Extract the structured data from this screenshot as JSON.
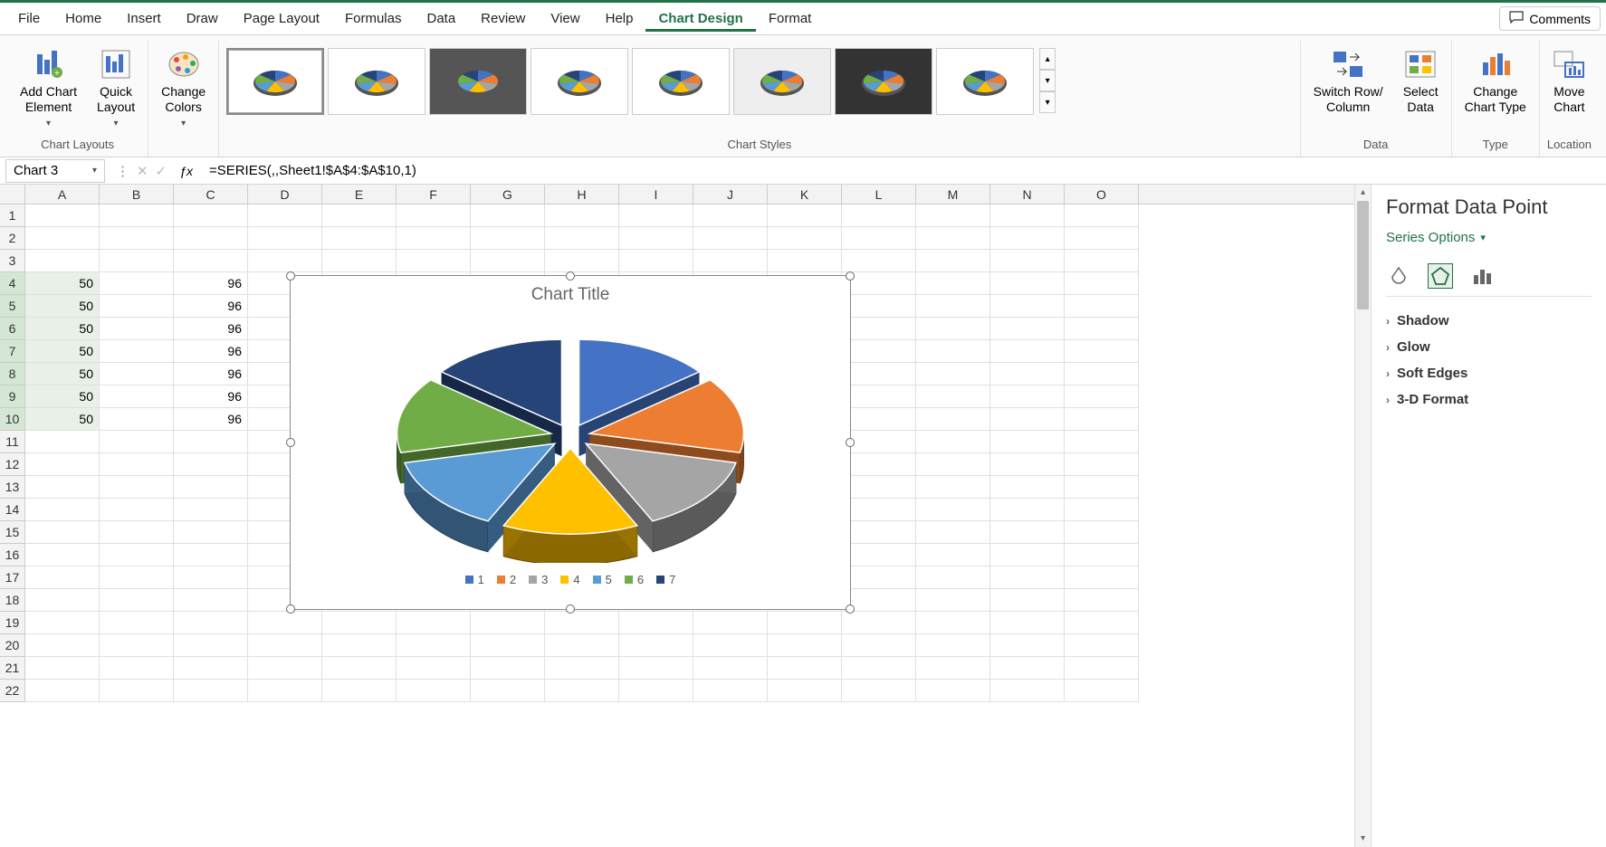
{
  "menu": {
    "items": [
      "File",
      "Home",
      "Insert",
      "Draw",
      "Page Layout",
      "Formulas",
      "Data",
      "Review",
      "View",
      "Help",
      "Chart Design",
      "Format"
    ],
    "active_index": 10,
    "comments": "Comments"
  },
  "ribbon": {
    "chart_layouts": {
      "label": "Chart Layouts",
      "add_element": "Add Chart\nElement",
      "quick_layout": "Quick\nLayout"
    },
    "change_colors": "Change\nColors",
    "chart_styles_label": "Chart Styles",
    "data": {
      "label": "Data",
      "switch": "Switch Row/\nColumn",
      "select": "Select\nData"
    },
    "type": {
      "label": "Type",
      "change": "Change\nChart Type"
    },
    "location": {
      "label": "Location",
      "move": "Move\nChart"
    }
  },
  "formula_bar": {
    "name_box": "Chart 3",
    "formula": "=SERIES(,,Sheet1!$A$4:$A$10,1)"
  },
  "grid": {
    "columns": [
      "A",
      "B",
      "C",
      "D",
      "E",
      "F",
      "G",
      "H",
      "I",
      "J",
      "K",
      "L",
      "M",
      "N",
      "O"
    ],
    "rows": [
      {
        "n": 1,
        "A": "",
        "B": "",
        "C": ""
      },
      {
        "n": 2,
        "A": "",
        "B": "",
        "C": ""
      },
      {
        "n": 3,
        "A": "",
        "B": "",
        "C": ""
      },
      {
        "n": 4,
        "A": "50",
        "B": "",
        "C": "96"
      },
      {
        "n": 5,
        "A": "50",
        "B": "",
        "C": "96"
      },
      {
        "n": 6,
        "A": "50",
        "B": "",
        "C": "96"
      },
      {
        "n": 7,
        "A": "50",
        "B": "",
        "C": "96"
      },
      {
        "n": 8,
        "A": "50",
        "B": "",
        "C": "96"
      },
      {
        "n": 9,
        "A": "50",
        "B": "",
        "C": "96"
      },
      {
        "n": 10,
        "A": "50",
        "B": "",
        "C": "96"
      },
      {
        "n": 11,
        "A": "",
        "B": "",
        "C": ""
      },
      {
        "n": 12,
        "A": "",
        "B": "",
        "C": ""
      },
      {
        "n": 13,
        "A": "",
        "B": "",
        "C": ""
      },
      {
        "n": 14,
        "A": "",
        "B": "",
        "C": ""
      },
      {
        "n": 15,
        "A": "",
        "B": "",
        "C": ""
      },
      {
        "n": 16,
        "A": "",
        "B": "",
        "C": ""
      },
      {
        "n": 17,
        "A": "",
        "B": "",
        "C": ""
      },
      {
        "n": 18,
        "A": "",
        "B": "",
        "C": ""
      },
      {
        "n": 19,
        "A": "",
        "B": "",
        "C": ""
      },
      {
        "n": 20,
        "A": "",
        "B": "",
        "C": ""
      },
      {
        "n": 21,
        "A": "",
        "B": "",
        "C": ""
      },
      {
        "n": 22,
        "A": "",
        "B": "",
        "C": ""
      }
    ],
    "selected_rows": [
      4,
      5,
      6,
      7,
      8,
      9,
      10
    ],
    "selected_col": "A"
  },
  "chart_data": {
    "type": "pie",
    "title": "Chart Title",
    "categories": [
      "1",
      "2",
      "3",
      "4",
      "5",
      "6",
      "7"
    ],
    "values": [
      50,
      50,
      50,
      50,
      50,
      50,
      50
    ],
    "colors": [
      "#4472C4",
      "#ED7D31",
      "#A5A5A5",
      "#FFC000",
      "#5B9BD5",
      "#70AD47",
      "#264478"
    ],
    "legend_labels": [
      "1",
      "2",
      "3",
      "4",
      "5",
      "6",
      "7"
    ],
    "exploded": true,
    "three_d": true
  },
  "format_pane": {
    "title": "Format Data Point",
    "subtitle": "Series Options",
    "sections": [
      "Shadow",
      "Glow",
      "Soft Edges",
      "3-D Format"
    ]
  }
}
